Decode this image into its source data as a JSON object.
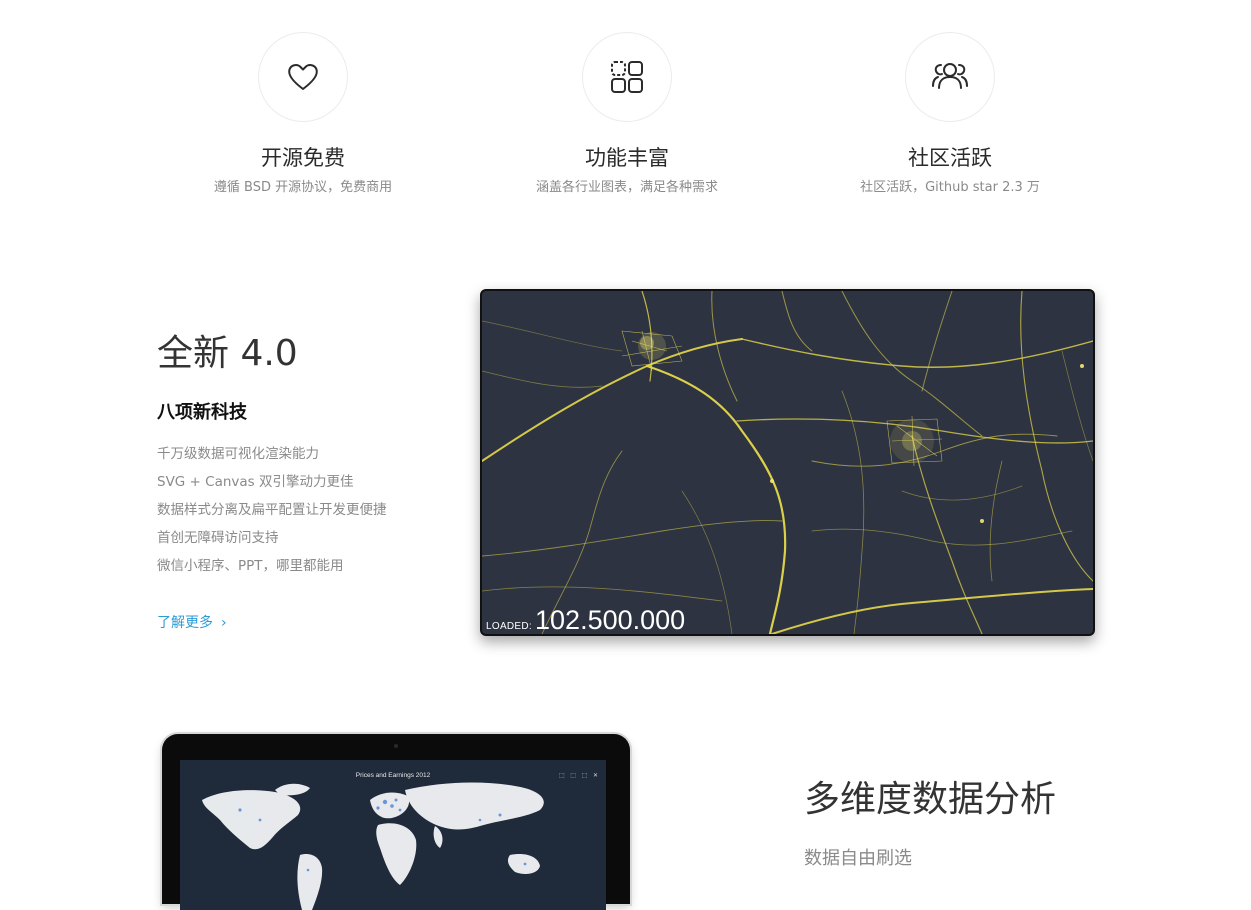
{
  "features": [
    {
      "icon": "heart-icon",
      "title": "开源免费",
      "desc": "遵循 BSD 开源协议，免费商用"
    },
    {
      "icon": "grid-icon",
      "title": "功能丰富",
      "desc": "涵盖各行业图表，满足各种需求"
    },
    {
      "icon": "users-icon",
      "title": "社区活跃",
      "desc": "社区活跃，Github star 2.3 万"
    }
  ],
  "release": {
    "title": "全新 4.0",
    "subtitle": "八项新科技",
    "items": [
      "千万级数据可视化渲染能力",
      "SVG + Canvas 双引擎动力更佳",
      "数据样式分离及扁平配置让开发更便捷",
      "首创无障碍访问支持",
      "微信小程序、PPT，哪里都能用"
    ],
    "learn_more": "了解更多",
    "chevron": "›",
    "demo": {
      "loaded_label": "LOADED:",
      "loaded_value": "102.500.000",
      "background_color": "#2d3341",
      "line_color": "#e6d84a"
    }
  },
  "analysis": {
    "title": "多维度数据分析",
    "subtitle": "数据自由刷选",
    "tablet": {
      "chart_title": "Prices and Earnings 2012",
      "toolbar": "⬚ ⬚ ⬚ ✕"
    }
  },
  "colors": {
    "accent": "#2e9bd6",
    "heading": "#333333",
    "muted": "#8a8a8a"
  }
}
